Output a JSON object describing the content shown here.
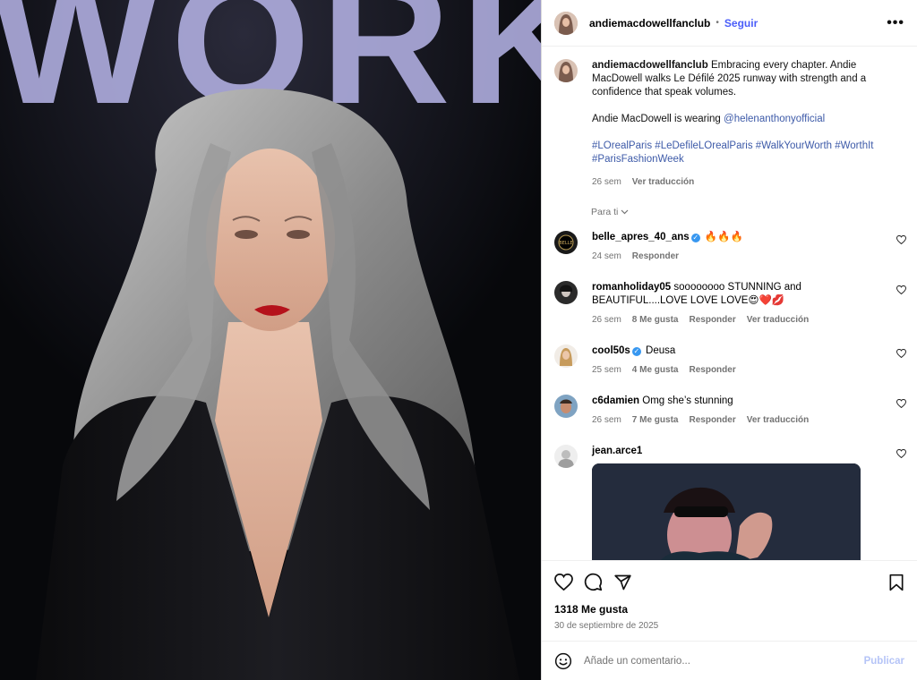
{
  "post": {
    "username": "andiemacdowellfanclub",
    "follow_label": "Seguir",
    "more_label": "•••",
    "caption_text": "Embracing every chapter. Andie MacDowell walks Le Défilé 2025 runway with strength and a confidence that speak volumes.",
    "caption_wearing_prefix": "Andie MacDowell is wearing ",
    "caption_mention": "@helenanthonyofficial",
    "hashtags": "#LOrealParis #LeDefileLOrealParis #WalkYourWorth #WorthIt #ParisFashionWeek",
    "caption_time": "26 sem",
    "caption_translate": "Ver traducción",
    "para_ti": "Para ti",
    "likes": "1318 Me gusta",
    "date": "30 de septiembre de 2025",
    "add_comment_placeholder": "Añade un comentario...",
    "publish_label": "Publicar"
  },
  "comments": [
    {
      "user": "belle_apres_40_ans",
      "verified": true,
      "text": "🔥🔥🔥",
      "time": "24 sem",
      "likes": "",
      "reply": "Responder",
      "translate": ""
    },
    {
      "user": "romanholiday05",
      "verified": false,
      "text": "soooooooo STUNNING and BEAUTIFUL....LOVE LOVE LOVE😍❤️💋",
      "time": "26 sem",
      "likes": "8 Me gusta",
      "reply": "Responder",
      "translate": "Ver traducción"
    },
    {
      "user": "cool50s",
      "verified": true,
      "text": "Deusa",
      "time": "25 sem",
      "likes": "4 Me gusta",
      "reply": "Responder",
      "translate": ""
    },
    {
      "user": "c6damien",
      "verified": false,
      "text": "Omg she’s stunning",
      "time": "26 sem",
      "likes": "7 Me gusta",
      "reply": "Responder",
      "translate": "Ver traducción"
    },
    {
      "user": "jean.arce1",
      "verified": false,
      "text": "",
      "time": "",
      "likes": "",
      "reply": "",
      "translate": ""
    }
  ],
  "media": {
    "backdrop_text": "WORK"
  },
  "colors": {
    "accent": "#4a5df9",
    "link": "#3d5aa8",
    "verified": "#3797f0"
  }
}
